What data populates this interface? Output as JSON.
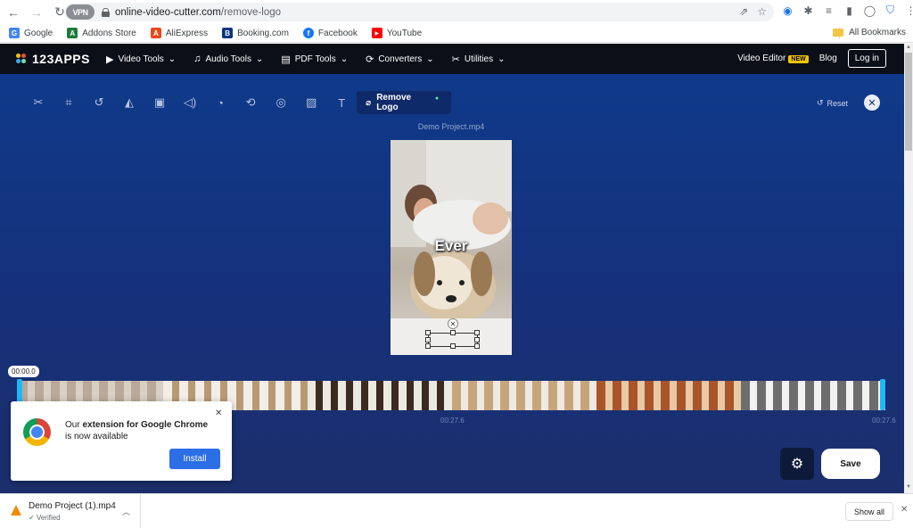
{
  "browser": {
    "url_host": "online-video-cutter.com",
    "url_path": "/remove-logo",
    "vpn_label": "VPN",
    "ext_badge": "1"
  },
  "bookmarks": {
    "items": [
      {
        "label": "Google",
        "color": "#4285f4",
        "glyph": "G"
      },
      {
        "label": "Addons Store",
        "color": "#1f7a3b",
        "glyph": "A"
      },
      {
        "label": "AliExpress",
        "color": "#e8491d",
        "glyph": "A"
      },
      {
        "label": "Booking.com",
        "color": "#003580",
        "glyph": "B"
      },
      {
        "label": "Facebook",
        "color": "#1877f2",
        "glyph": "f"
      },
      {
        "label": "YouTube",
        "color": "#ff0000",
        "glyph": "▶"
      }
    ],
    "all_label": "All Bookmarks"
  },
  "app": {
    "logo_text": "123APPS",
    "menu": [
      {
        "label": "Video Tools",
        "icon": "video-icon",
        "glyph": "▶"
      },
      {
        "label": "Audio Tools",
        "icon": "audio-icon",
        "glyph": "♫"
      },
      {
        "label": "PDF Tools",
        "icon": "pdf-icon",
        "glyph": "▤"
      },
      {
        "label": "Converters",
        "icon": "converters-icon",
        "glyph": "⟳"
      },
      {
        "label": "Utilities",
        "icon": "utilities-icon",
        "glyph": "✂"
      }
    ],
    "video_editor_label": "Video Editor",
    "new_badge": "NEW",
    "blog_label": "Blog",
    "login_label": "Log in"
  },
  "editor": {
    "tools": [
      {
        "name": "cut-icon",
        "glyph": "✂"
      },
      {
        "name": "crop-icon",
        "glyph": "⌗"
      },
      {
        "name": "rotate-icon",
        "glyph": "↺"
      },
      {
        "name": "flip-icon",
        "glyph": "◭"
      },
      {
        "name": "resize-icon",
        "glyph": "▣"
      },
      {
        "name": "volume-icon",
        "glyph": "🔈"
      },
      {
        "name": "speed-icon",
        "glyph": "◔"
      },
      {
        "name": "loop-icon",
        "glyph": "⟲"
      },
      {
        "name": "stabilize-icon",
        "glyph": "◎"
      },
      {
        "name": "add-image-icon",
        "glyph": "▨"
      },
      {
        "name": "add-text-icon",
        "glyph": "T"
      }
    ],
    "active_tool_label": "Remove Logo",
    "reset_label": "Reset",
    "project_name": "Demo Project.mp4",
    "video_caption": "Ever",
    "timestamp": "00:00.0",
    "timeline_mid": "00:27.6",
    "timeline_end": "00:27.6",
    "save_label": "Save"
  },
  "popup": {
    "text_pre": "Our ",
    "text_bold1": "extension for Google Chrome",
    "text_post": " is now available",
    "install_label": "Install"
  },
  "downloads": {
    "file_name": "Demo Project (1).mp4",
    "status": "Verified",
    "show_all_label": "Show all"
  }
}
